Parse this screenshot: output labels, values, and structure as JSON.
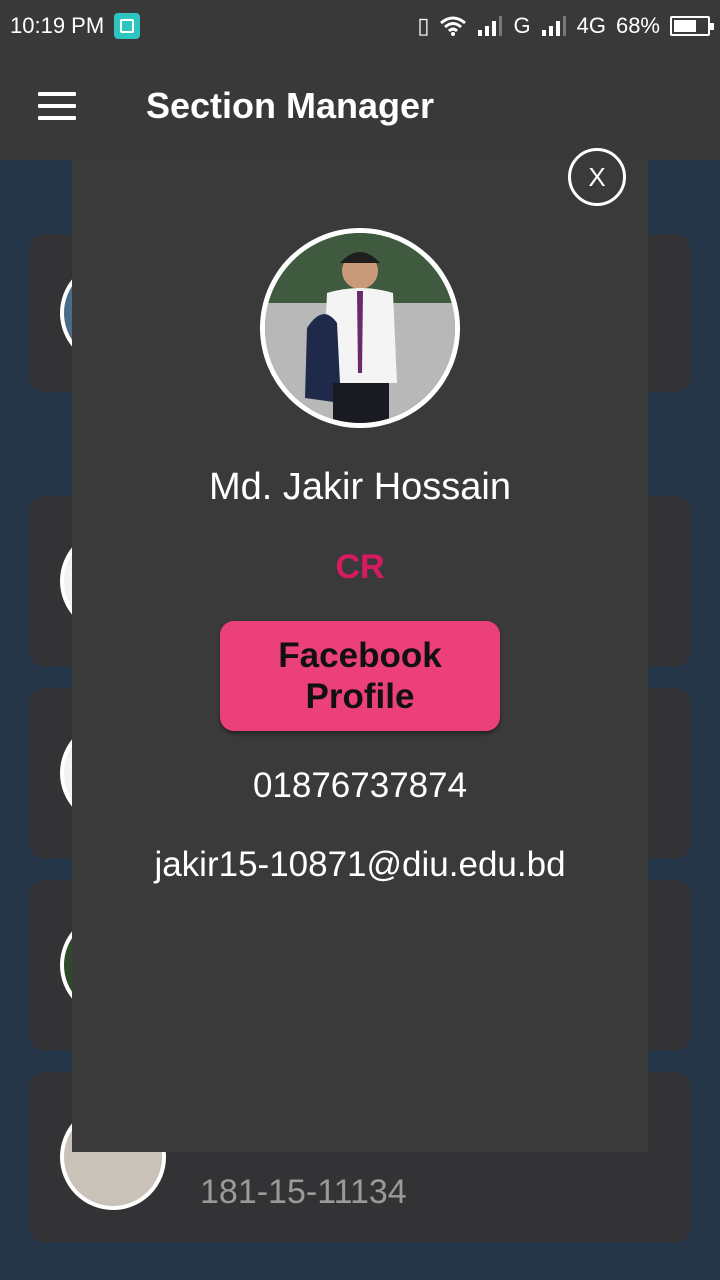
{
  "status_bar": {
    "time": "10:19 PM",
    "network_g": "G",
    "network_4g": "4G",
    "battery": "68%",
    "battery_level": 0.68,
    "icons": [
      "screenshot-icon",
      "vibrate-icon",
      "wifi-icon",
      "signal-icon",
      "signal-icon",
      "battery-icon"
    ]
  },
  "app_bar": {
    "title": "Section Manager",
    "menu_icon": "menu-icon"
  },
  "background_list": {
    "visible_id": "181-15-11134"
  },
  "profile_dialog": {
    "close_label": "X",
    "name": "Md. Jakir Hossain",
    "role": "CR",
    "facebook_button": "Facebook Profile",
    "phone": "01876737874",
    "email": "jakir15-10871@diu.edu.bd"
  },
  "colors": {
    "background": "#243647",
    "app_bar": "#3a393a",
    "dialog": "#3b3a3b",
    "accent_pink": "#ec407a",
    "role_text": "#d81b60"
  }
}
